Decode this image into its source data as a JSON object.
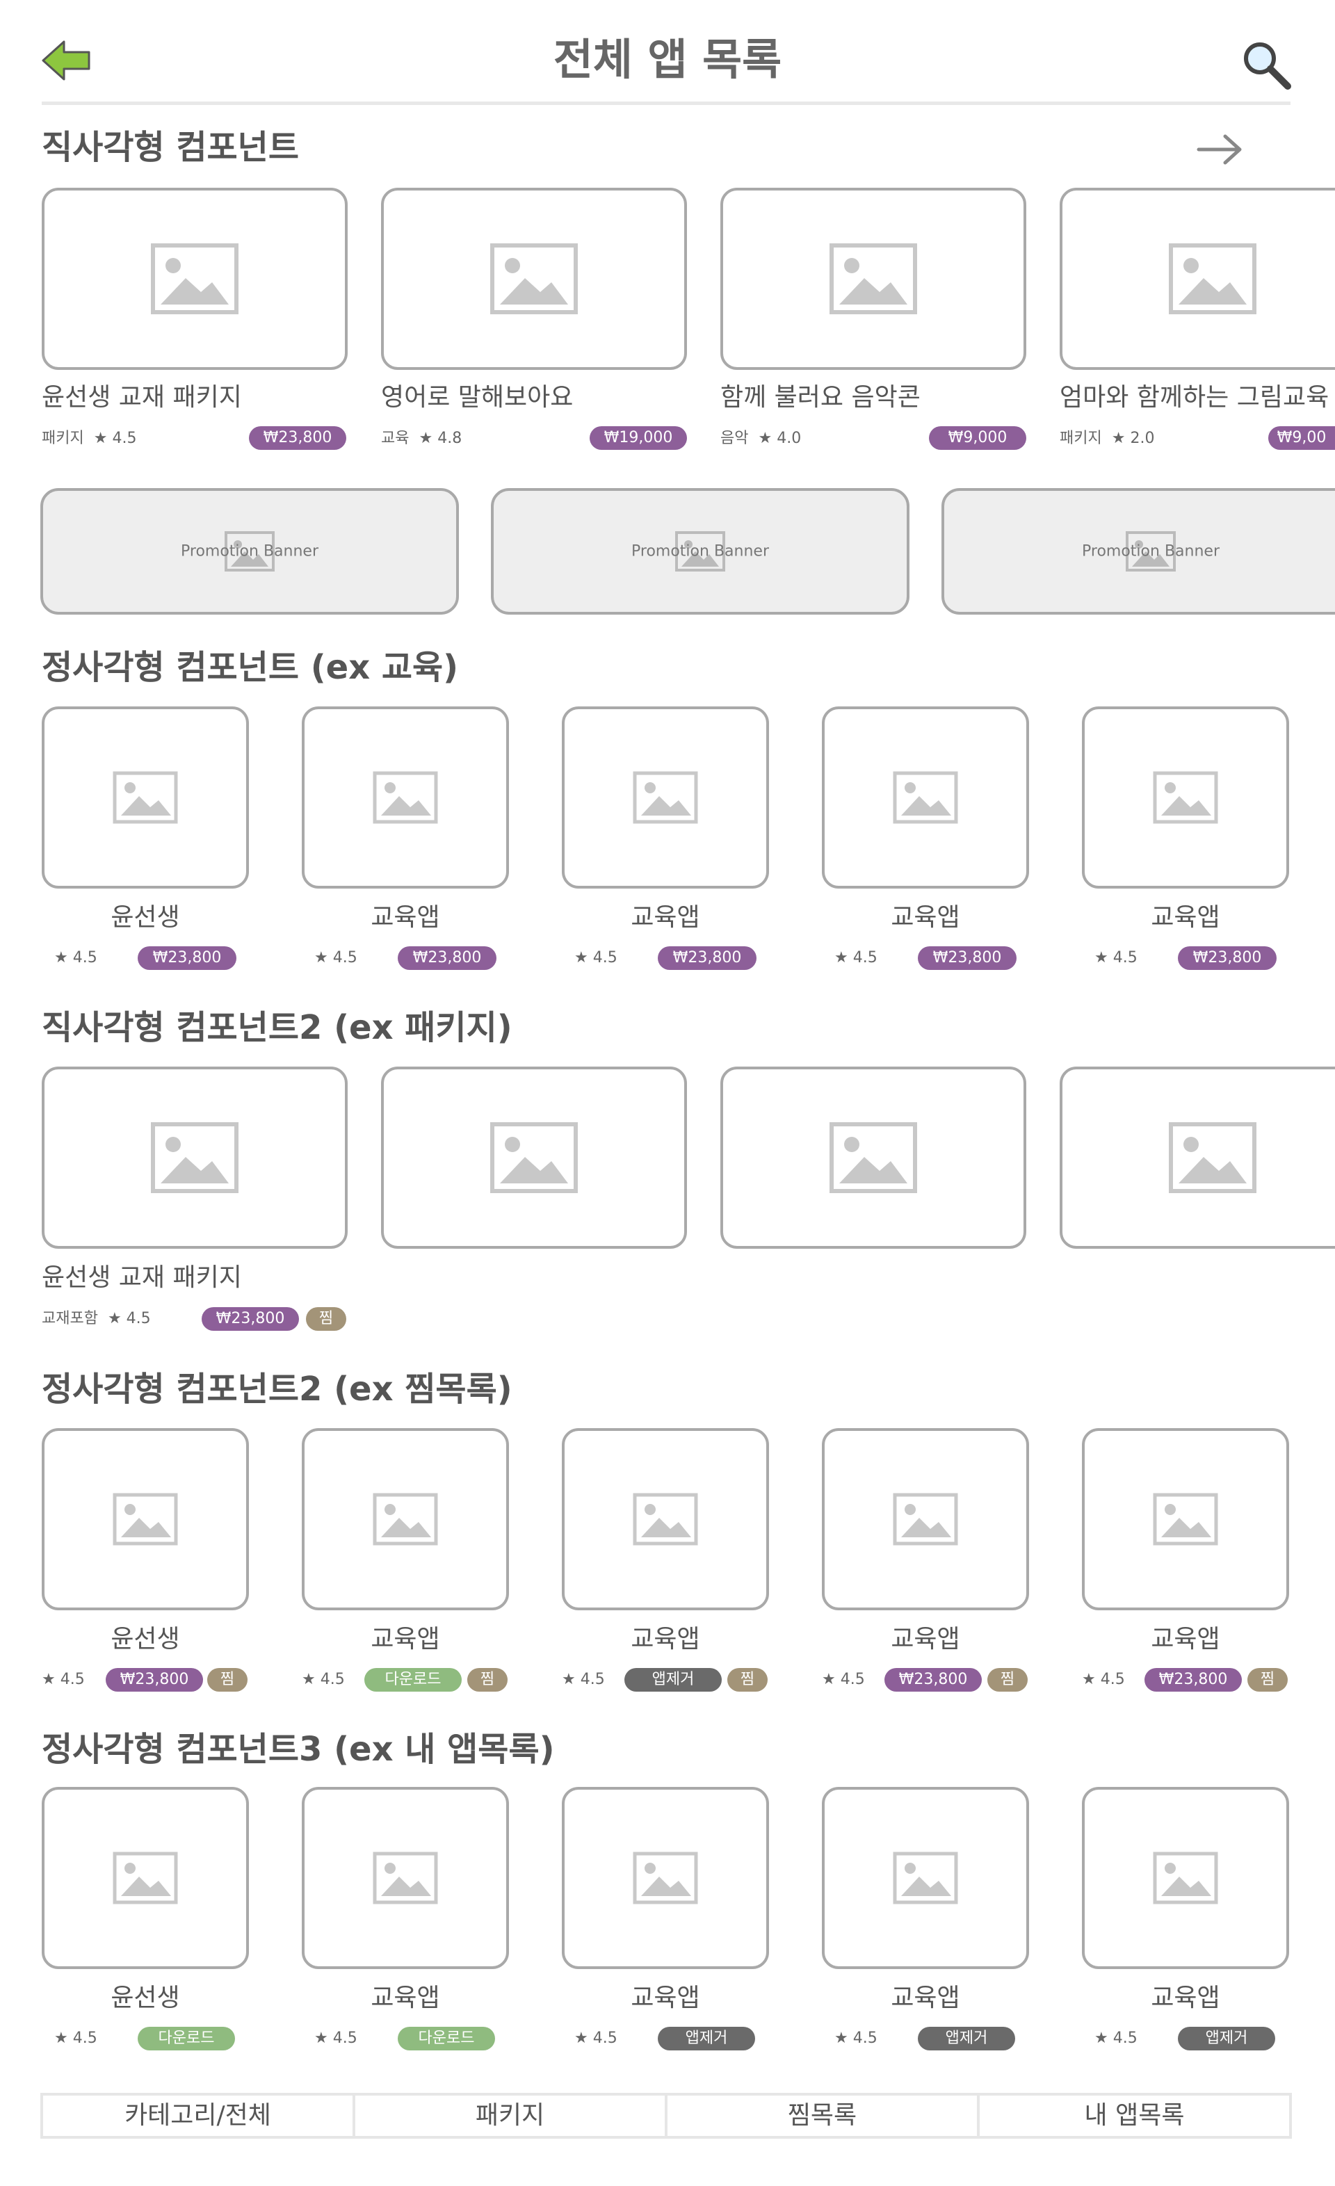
{
  "header": {
    "title": "전체 앱 목록",
    "back_icon": "back-arrow-icon",
    "search_icon": "search-icon",
    "accent": "#8dc63f"
  },
  "section1": {
    "title": "직사각형 컴포넌트",
    "more_icon": "arrow-right-icon",
    "items": [
      {
        "name": "윤선생 교재 패키지",
        "category": "패키지",
        "rating": "★ 4.5",
        "price": "₩23,800"
      },
      {
        "name": "영어로 말해보아요",
        "category": "교육",
        "rating": "★ 4.8",
        "price": "₩19,000"
      },
      {
        "name": "함께 불러요 음악콘",
        "category": "음악",
        "rating": "★ 4.0",
        "price": "₩9,000"
      },
      {
        "name": "엄마와 함께하는 그림교육",
        "category": "패키지",
        "rating": "★ 2.0",
        "price": "₩9,00"
      }
    ]
  },
  "banners": [
    {
      "label": "Promotion Banner"
    },
    {
      "label": "Promotion Banner"
    },
    {
      "label": "Promotion Banner"
    }
  ],
  "section2": {
    "title": "정사각형 컴포넌트 (ex 교육)",
    "items": [
      {
        "name": "윤선생",
        "rating": "★ 4.5",
        "price": "₩23,800"
      },
      {
        "name": "교육앱",
        "rating": "★ 4.5",
        "price": "₩23,800"
      },
      {
        "name": "교육앱",
        "rating": "★ 4.5",
        "price": "₩23,800"
      },
      {
        "name": "교육앱",
        "rating": "★ 4.5",
        "price": "₩23,800"
      },
      {
        "name": "교육앱",
        "rating": "★ 4.5",
        "price": "₩23,800"
      }
    ]
  },
  "section3": {
    "title": "직사각형 컴포넌트2 (ex 패키지)",
    "item": {
      "name": "윤선생 교재 패키지",
      "category": "교재포함",
      "rating": "★ 4.5",
      "price": "₩23,800",
      "zzim": "찜"
    }
  },
  "section4": {
    "title": "정사각형 컴포넌트2 (ex 찜목록)",
    "items": [
      {
        "name": "윤선생",
        "rating": "★ 4.5",
        "action": "₩23,800",
        "action_type": "price",
        "zzim": "찜"
      },
      {
        "name": "교육앱",
        "rating": "★ 4.5",
        "action": "다운로드",
        "action_type": "dl",
        "zzim": "찜"
      },
      {
        "name": "교육앱",
        "rating": "★ 4.5",
        "action": "앱제거",
        "action_type": "rm",
        "zzim": "찜"
      },
      {
        "name": "교육앱",
        "rating": "★ 4.5",
        "action": "₩23,800",
        "action_type": "price",
        "zzim": "찜"
      },
      {
        "name": "교육앱",
        "rating": "★ 4.5",
        "action": "₩23,800",
        "action_type": "price",
        "zzim": "찜"
      }
    ]
  },
  "section5": {
    "title": "정사각형 컴포넌트3 (ex 내 앱목록)",
    "items": [
      {
        "name": "윤선생",
        "rating": "★ 4.5",
        "action": "다운로드",
        "action_type": "dl"
      },
      {
        "name": "교육앱",
        "rating": "★ 4.5",
        "action": "다운로드",
        "action_type": "dl"
      },
      {
        "name": "교육앱",
        "rating": "★ 4.5",
        "action": "앱제거",
        "action_type": "rm"
      },
      {
        "name": "교육앱",
        "rating": "★ 4.5",
        "action": "앱제거",
        "action_type": "rm"
      },
      {
        "name": "교육앱",
        "rating": "★ 4.5",
        "action": "앱제거",
        "action_type": "rm"
      }
    ]
  },
  "tabs": [
    "카테고리/전체",
    "패키지",
    "찜목록",
    "내 앱목록"
  ],
  "colors": {
    "price_pill": "#8d5f99",
    "zzim_pill": "#a39478",
    "download_pill": "#8fbb7f",
    "remove_pill": "#6a6a6a",
    "card_border": "#a9a9a9",
    "banner_bg": "#eeeeee"
  }
}
